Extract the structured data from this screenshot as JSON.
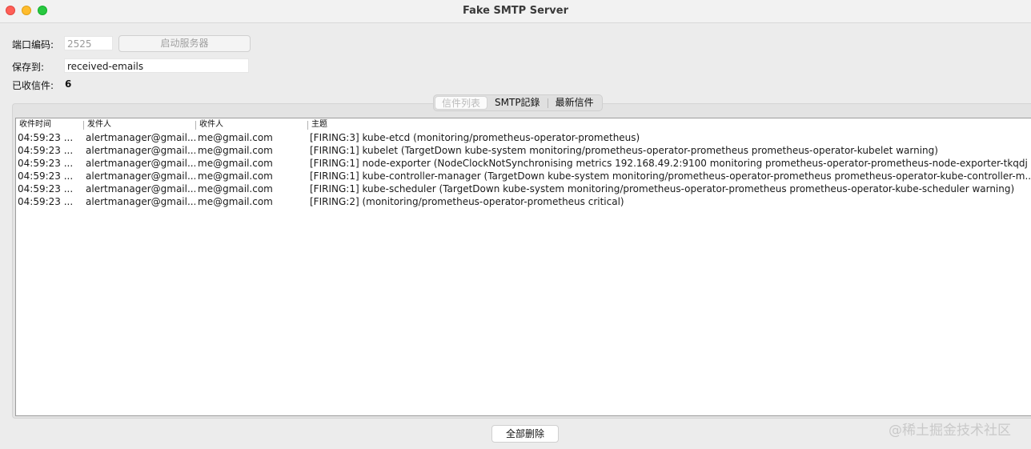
{
  "window": {
    "title": "Fake SMTP Server"
  },
  "form": {
    "port_label": "端口编码:",
    "port_value": "2525",
    "start_button": "启动服务器",
    "save_label": "保存到:",
    "save_value": "received-emails",
    "received_label": "已收信件:",
    "received_count": "6"
  },
  "tabs": [
    "信件列表",
    "SMTP記錄",
    "最新信件"
  ],
  "table": {
    "headers": [
      "收件时间",
      "发件人",
      "收件人",
      "主题"
    ],
    "rows": [
      [
        "04:59:23 ...",
        "alertmanager@gmail....",
        "me@gmail.com",
        "[FIRING:3] kube-etcd (monitoring/prometheus-operator-prometheus)"
      ],
      [
        "04:59:23 ...",
        "alertmanager@gmail....",
        "me@gmail.com",
        "[FIRING:1] kubelet (TargetDown kube-system monitoring/prometheus-operator-prometheus prometheus-operator-kubelet warning)"
      ],
      [
        "04:59:23 ...",
        "alertmanager@gmail....",
        "me@gmail.com",
        "[FIRING:1] node-exporter (NodeClockNotSynchronising metrics 192.168.49.2:9100 monitoring prometheus-operator-prometheus-node-exporter-tkqdj ..."
      ],
      [
        "04:59:23 ...",
        "alertmanager@gmail....",
        "me@gmail.com",
        "[FIRING:1] kube-controller-manager (TargetDown kube-system monitoring/prometheus-operator-prometheus prometheus-operator-kube-controller-m..."
      ],
      [
        "04:59:23 ...",
        "alertmanager@gmail....",
        "me@gmail.com",
        "[FIRING:1] kube-scheduler (TargetDown kube-system monitoring/prometheus-operator-prometheus prometheus-operator-kube-scheduler warning)"
      ],
      [
        "04:59:23 ...",
        "alertmanager@gmail....",
        "me@gmail.com",
        "[FIRING:2]  (monitoring/prometheus-operator-prometheus critical)"
      ]
    ]
  },
  "footer": {
    "delete_all": "全部删除"
  },
  "watermark": "@稀土掘金技术社区"
}
